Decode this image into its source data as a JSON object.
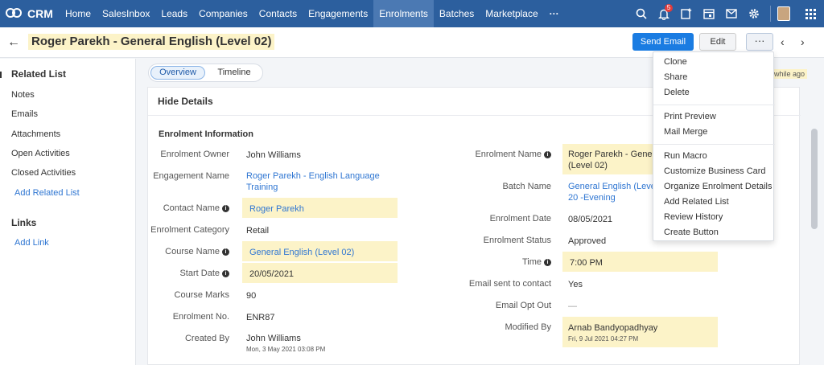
{
  "topnav": {
    "logo": "CRM",
    "items": [
      "Home",
      "SalesInbox",
      "Leads",
      "Companies",
      "Contacts",
      "Engagements",
      "Enrolments",
      "Batches",
      "Marketplace"
    ],
    "more": "···",
    "notification_count": "5",
    "colors": {
      "bar": "#2c5f9e",
      "active": "#4b79b3"
    }
  },
  "record": {
    "title": "Roger Parekh - General English (Level 02)",
    "send_email": "Send Email",
    "edit": "Edit",
    "more": "···",
    "updated_ago": "while ago"
  },
  "sidebar": {
    "related_list": "Related List",
    "items": [
      "Notes",
      "Emails",
      "Attachments",
      "Open Activities",
      "Closed Activities"
    ],
    "add_related_list": "Add Related List",
    "links": "Links",
    "add_link": "Add Link"
  },
  "tabs": {
    "overview": "Overview",
    "timeline": "Timeline"
  },
  "details": {
    "hide_details": "Hide Details",
    "section_title": "Enrolment Information",
    "left": {
      "enrolment_owner": {
        "label": "Enrolment Owner",
        "value": "John Williams"
      },
      "engagement_name": {
        "label": "Engagement Name",
        "value1": "Roger Parekh - English Language",
        "value2": "Training"
      },
      "contact_name": {
        "label": "Contact Name",
        "value": "Roger Parekh"
      },
      "enrolment_category": {
        "label": "Enrolment Category",
        "value": "Retail"
      },
      "course_name": {
        "label": "Course Name",
        "value": "General English (Level 02)"
      },
      "start_date": {
        "label": "Start Date",
        "value": "20/05/2021"
      },
      "course_marks": {
        "label": "Course Marks",
        "value": "90"
      },
      "enrolment_no": {
        "label": "Enrolment No.",
        "value": "ENR87"
      },
      "created_by": {
        "label": "Created By",
        "value": "John Williams",
        "sub": "Mon, 3 May 2021 03:08 PM"
      }
    },
    "right": {
      "enrolment_name": {
        "label": "Enrolment Name",
        "value1": "Roger Parekh - General",
        "value2": "(Level 02)"
      },
      "batch_name": {
        "label": "Batch Name",
        "value1": "General English (Level 0",
        "value2": "20 -Evening"
      },
      "enrolment_date": {
        "label": "Enrolment Date",
        "value": "08/05/2021"
      },
      "enrolment_status": {
        "label": "Enrolment Status",
        "value": "Approved"
      },
      "time": {
        "label": "Time",
        "value": "7:00 PM"
      },
      "email_sent": {
        "label": "Email sent to contact",
        "value": "Yes"
      },
      "email_opt_out": {
        "label": "Email Opt Out",
        "value": "—"
      },
      "modified_by": {
        "label": "Modified By",
        "value": "Arnab Bandyopadhyay",
        "sub": "Fri, 9 Jul 2021 04:27 PM"
      }
    }
  },
  "menu": {
    "group1": [
      "Clone",
      "Share",
      "Delete"
    ],
    "group2": [
      "Print Preview",
      "Mail Merge"
    ],
    "group3": [
      "Run Macro",
      "Customize Business Card",
      "Organize Enrolment Details",
      "Add Related List",
      "Review History",
      "Create Button"
    ]
  }
}
